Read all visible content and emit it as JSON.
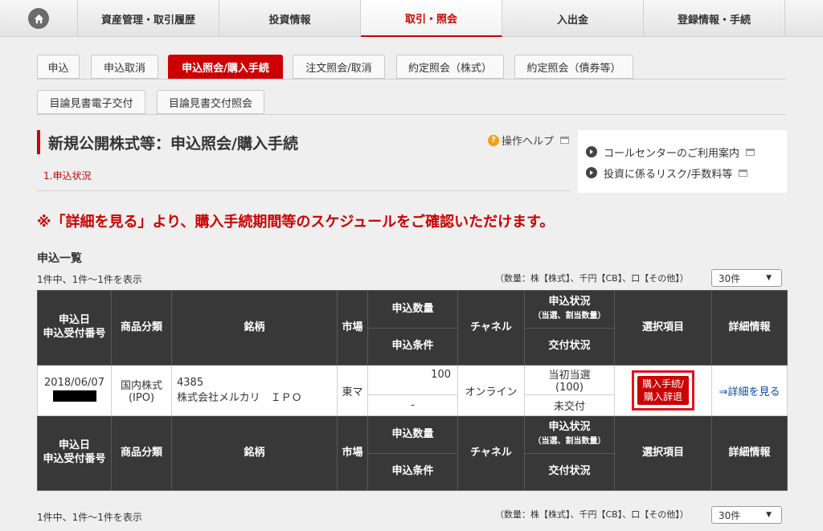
{
  "nav": {
    "items": [
      {
        "label": "資産管理・取引履歴"
      },
      {
        "label": "投資情報"
      },
      {
        "label": "取引・照会"
      },
      {
        "label": "入出金"
      },
      {
        "label": "登録情報・手続"
      }
    ],
    "active_index": 2
  },
  "subtabs": {
    "row1": [
      "申込",
      "申込取消",
      "申込照会/購入手続",
      "注文照会/取消",
      "約定照会（株式）",
      "約定照会（債券等）"
    ],
    "row2": [
      "目論見書電子交付",
      "目論見書交付照会"
    ],
    "active": "申込照会/購入手続"
  },
  "page": {
    "title": "新規公開株式等：申込照会/購入手続",
    "help": "操作ヘルプ",
    "step": "1.申込状況",
    "notice": "※「詳細を見る」より、購入手続期間等のスケジュールをご確認いただけます。"
  },
  "links": {
    "call_center": "コールセンターのご利用案内",
    "risk_fee": "投資に係るリスク/手数料等"
  },
  "list": {
    "heading": "申込一覧",
    "count_text": "1件中、1件〜1件を表示",
    "unit_note": "（数量：株【株式】、千円【CB】、口【その他】）",
    "per_page": "30件"
  },
  "table": {
    "headers": {
      "date": "申込日",
      "receipt_no": "申込受付番号",
      "product_class": "商品分類",
      "issue": "銘柄",
      "market": "市場",
      "qty": "申込数量",
      "condition": "申込条件",
      "channel": "チャネル",
      "status": "申込状況",
      "status_sub": "（当選、割当数量）",
      "delivery": "交付状況",
      "select": "選択項目",
      "detail": "詳細情報"
    },
    "rows": [
      {
        "date": "2018/06/07",
        "class_line1": "国内株式",
        "class_line2": "(IPO)",
        "code": "4385",
        "name": "株式会社メルカリ　ＩＰＯ",
        "market": "東マ",
        "qty": "100",
        "condition": "-",
        "channel": "オンライン",
        "status_line1": "当初当選",
        "status_line2": "(100)",
        "delivery": "未交付",
        "action_line1": "購入手続/",
        "action_line2": "購入辞退",
        "detail": "⇒詳細を見る"
      }
    ]
  }
}
